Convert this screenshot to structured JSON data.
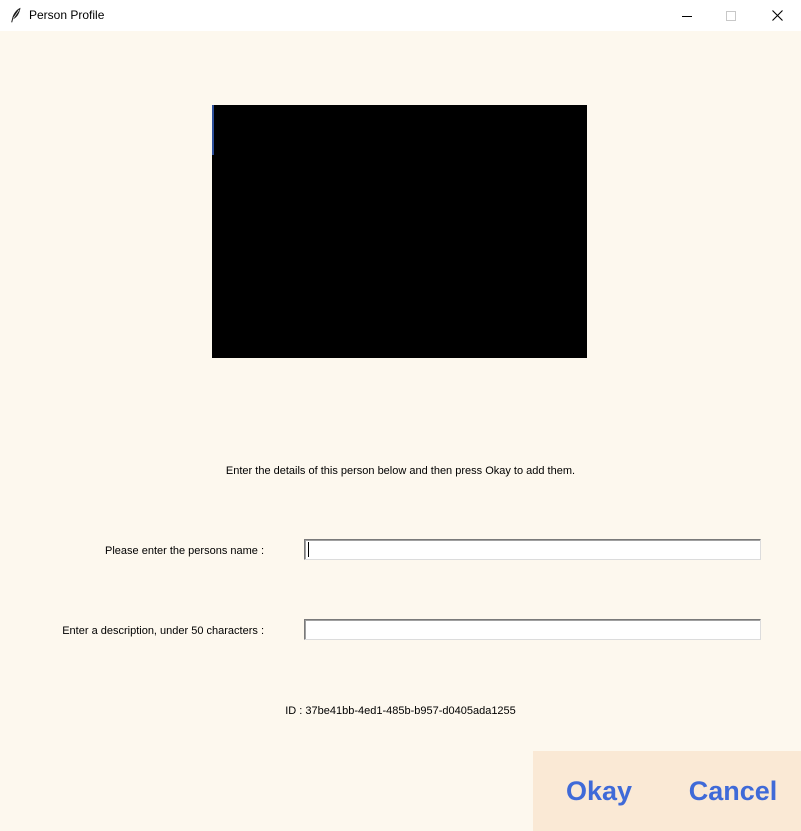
{
  "window": {
    "title": "Person Profile",
    "icon": "feather-icon",
    "controls": {
      "minimize_icon": "minimize-icon",
      "maximize_icon": "maximize-icon",
      "close_icon": "close-icon"
    }
  },
  "main": {
    "instructions": "Enter the details of this person below and then press Okay to add them.",
    "name_field": {
      "label": "Please enter the persons name :",
      "value": "",
      "placeholder": ""
    },
    "description_field": {
      "label": "Enter a description, under 50 characters :",
      "value": "",
      "placeholder": ""
    },
    "id_text": "ID : 37be41bb-4ed1-485b-b957-d0405ada1255"
  },
  "buttons": {
    "okay_label": "Okay",
    "cancel_label": "Cancel"
  },
  "colors": {
    "background": "#fdf8ee",
    "button_panel": "#fae9d5",
    "button_text": "#3f6ad8",
    "video_frame": "#000000"
  }
}
